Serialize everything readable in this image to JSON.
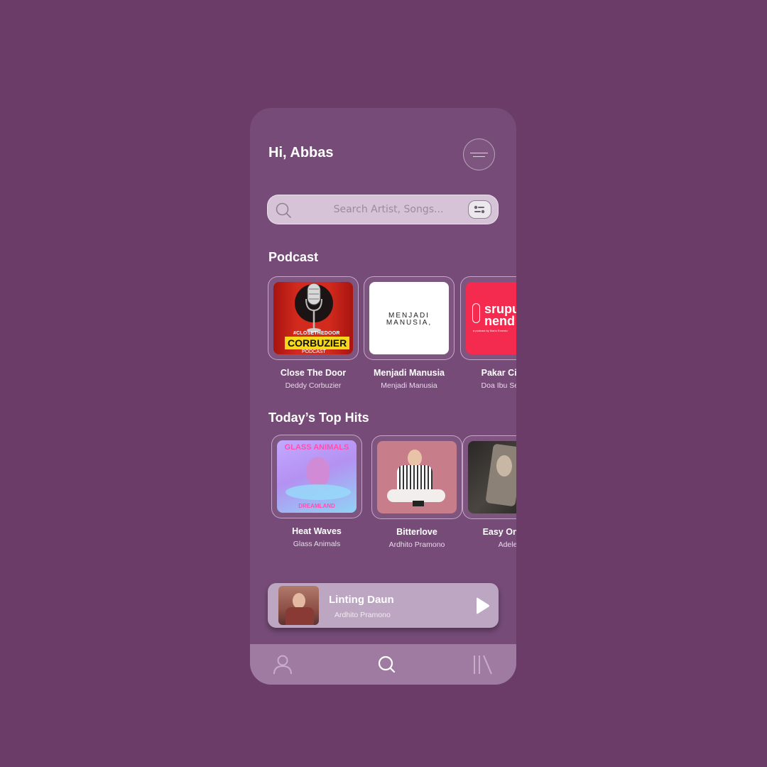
{
  "header": {
    "greeting": "Hi, Abbas"
  },
  "search": {
    "placeholder": "Search Artist, Songs..."
  },
  "podcast": {
    "title": "Podcast",
    "items": [
      {
        "title": "Close The Door",
        "subtitle": "Deddy Corbuzier",
        "art_text_1": "#CLOSETHEDOOR",
        "art_text_2": "CORBUZIER",
        "art_text_3": "PODCAST"
      },
      {
        "title": "Menjadi Manusia",
        "subtitle": "Menjadi Manusia",
        "art_text_1": "MENJADI",
        "art_text_2": "MANUSIA,"
      },
      {
        "title": "Pakar Cinta",
        "subtitle": "Doa Ibu Selalu",
        "art_text_1": "srupu",
        "art_text_2": "nend",
        "art_text_3": "a podcast by Marlo Ernesto"
      }
    ]
  },
  "top_hits": {
    "title": "Today’s Top Hits",
    "items": [
      {
        "title": "Heat Waves",
        "subtitle": "Glass Animals",
        "art_text_1": "GLASS ANIMALS",
        "art_text_2": "DREAMLAND"
      },
      {
        "title": "Bitterlove",
        "subtitle": "Ardhito Pramono"
      },
      {
        "title": "Easy On Me",
        "subtitle": "Adele"
      }
    ]
  },
  "now_playing": {
    "title": "Linting Daun",
    "artist": "Ardhito Pramono"
  },
  "nav": {
    "items": [
      "profile-icon",
      "search-icon",
      "library-icon"
    ]
  },
  "colors": {
    "background": "#6b3c68",
    "card": "#764b78",
    "now_playing": "#bca6c1",
    "nav": "#9f7ba2"
  }
}
